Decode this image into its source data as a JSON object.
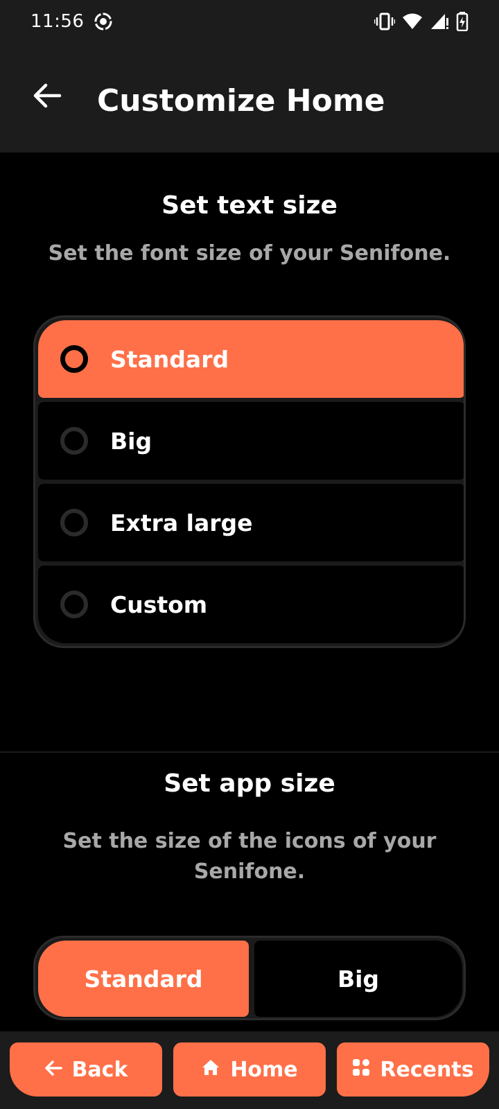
{
  "status_bar": {
    "time": "11:56",
    "icons": [
      "screen-record-icon",
      "vibrate-icon",
      "wifi-icon",
      "signal-icon",
      "battery-charging-icon"
    ]
  },
  "app_bar": {
    "title": "Customize Home",
    "back_icon": "arrow-left-icon"
  },
  "text_size": {
    "title": "Set text size",
    "subtitle": "Set the font size of your Senifone.",
    "options": [
      {
        "label": "Standard",
        "selected": true
      },
      {
        "label": "Big",
        "selected": false
      },
      {
        "label": "Extra large",
        "selected": false
      },
      {
        "label": "Custom",
        "selected": false
      }
    ]
  },
  "app_size": {
    "title": "Set app size",
    "subtitle": "Set the size of the icons of your Senifone.",
    "options": [
      {
        "label": "Standard",
        "selected": true
      },
      {
        "label": "Big",
        "selected": false
      }
    ]
  },
  "bottom_nav": {
    "back": "Back",
    "home": "Home",
    "recents": "Recents"
  },
  "colors": {
    "accent": "#ff7048",
    "bar_bg": "#1c1c1c",
    "page_bg": "#000000",
    "muted_text": "#a8a8a8"
  }
}
